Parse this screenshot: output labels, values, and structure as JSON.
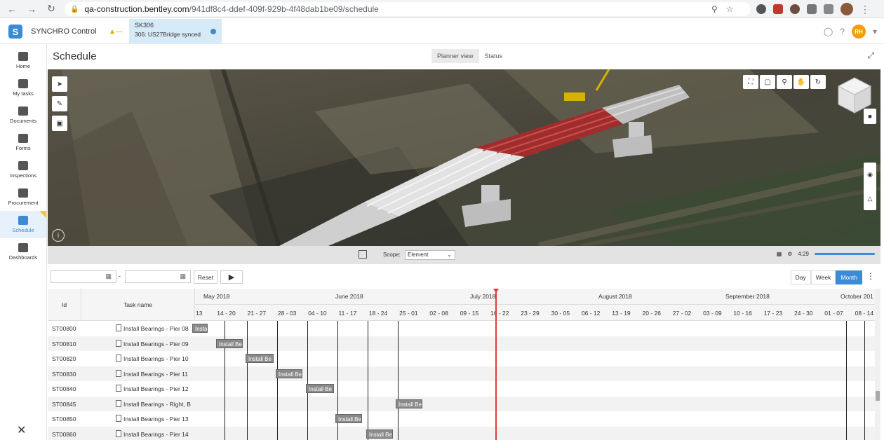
{
  "browser": {
    "url_host": "qa-construction.bentley.com",
    "url_path": "/941df8c4-ddef-409f-929b-4f48dab1be09/schedule"
  },
  "app": {
    "name": "SYNCHRO Control",
    "project_code": "SK306",
    "project_sub": "306: US27Bridge synced",
    "user_initials": "RH"
  },
  "nav": [
    {
      "label": "Home"
    },
    {
      "label": "My tasks"
    },
    {
      "label": "Documents"
    },
    {
      "label": "Forms"
    },
    {
      "label": "Inspections"
    },
    {
      "label": "Procurement"
    },
    {
      "label": "Schedule"
    },
    {
      "label": "Dashboards"
    }
  ],
  "page": {
    "title": "Schedule",
    "tabs": [
      "Planner view",
      "Status"
    ]
  },
  "viewport": {
    "scope_label": "Scope:",
    "scope_value": "Element",
    "slider_label": "4:29"
  },
  "gantt_controls": {
    "reset": "Reset",
    "scales": [
      "Day",
      "Week",
      "Month"
    ],
    "active_scale": "Month"
  },
  "gantt": {
    "col_id": "Id",
    "col_task": "Task name",
    "months": [
      "May 2018",
      "June 2018",
      "July 2018",
      "August 2018",
      "September 2018",
      "October 201"
    ],
    "weeks": [
      "13",
      "14 - 20",
      "21 - 27",
      "28 - 03",
      "04 - 10",
      "11 - 17",
      "18 - 24",
      "25 - 01",
      "02 - 08",
      "09 - 15",
      "16 - 22",
      "23 - 29",
      "30 - 05",
      "06 - 12",
      "13 - 19",
      "20 - 26",
      "27 - 02",
      "03 - 09",
      "10 - 16",
      "17 - 23",
      "24 - 30",
      "01 - 07",
      "08 - 14"
    ],
    "rows": [
      {
        "id": "ST00800",
        "task": "Install Bearings - Pier 08",
        "bar": "Install Be"
      },
      {
        "id": "ST00810",
        "task": "Install Bearings - Pier 09",
        "bar": "Install Be"
      },
      {
        "id": "ST00820",
        "task": "Install Bearings - Pier 10",
        "bar": "Install Be"
      },
      {
        "id": "ST00830",
        "task": "Install Bearings - Pier 11",
        "bar": "Install Be"
      },
      {
        "id": "ST00840",
        "task": "Install Bearings - Pier 12",
        "bar": "Install Be"
      },
      {
        "id": "ST00845",
        "task": "Install Bearings - Right, B",
        "bar": "Install Be"
      },
      {
        "id": "ST00850",
        "task": "Install Bearings - Pier 13",
        "bar": "Install Be"
      },
      {
        "id": "ST00860",
        "task": "Install Bearings - Pier 14",
        "bar": "Install Be"
      }
    ]
  },
  "colors": {
    "accent": "#3c8bd6",
    "today": "#e53935",
    "bar": "#8a8a8a"
  }
}
